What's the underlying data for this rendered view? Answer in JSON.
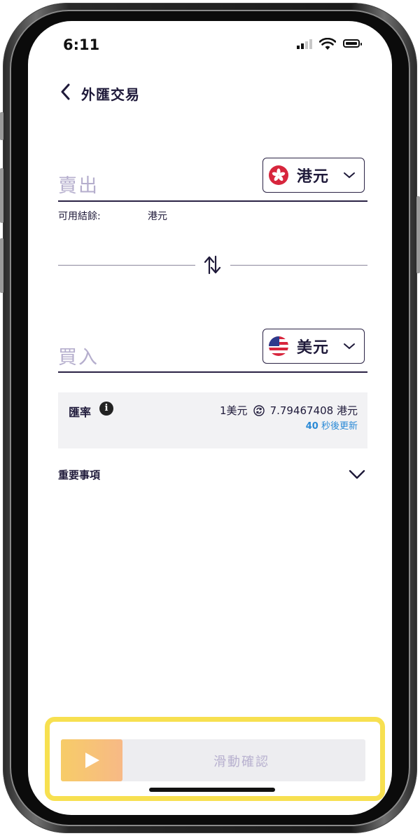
{
  "status_bar": {
    "time": "6:11"
  },
  "header": {
    "title": "外匯交易"
  },
  "sell": {
    "label": "賣出",
    "currency": "港元",
    "available_label": "可用結餘:",
    "available_currency": "港元"
  },
  "buy": {
    "label": "買入",
    "currency": "美元"
  },
  "rate": {
    "label": "匯率",
    "info_glyph": "i",
    "from": "1美元",
    "to": "7.79467408 港元",
    "refresh_seconds": "40",
    "refresh_suffix": " 秒後更新"
  },
  "notes": {
    "label": "重要事項"
  },
  "slider": {
    "label": "滑動確認"
  },
  "colors": {
    "accent_text": "#1f1a3a",
    "placeholder": "#b5aecd",
    "link_blue": "#2b8ad6",
    "slider_gradient_start": "#f7cc68",
    "slider_gradient_end": "#f7b986",
    "highlight_yellow": "#f7e050"
  }
}
